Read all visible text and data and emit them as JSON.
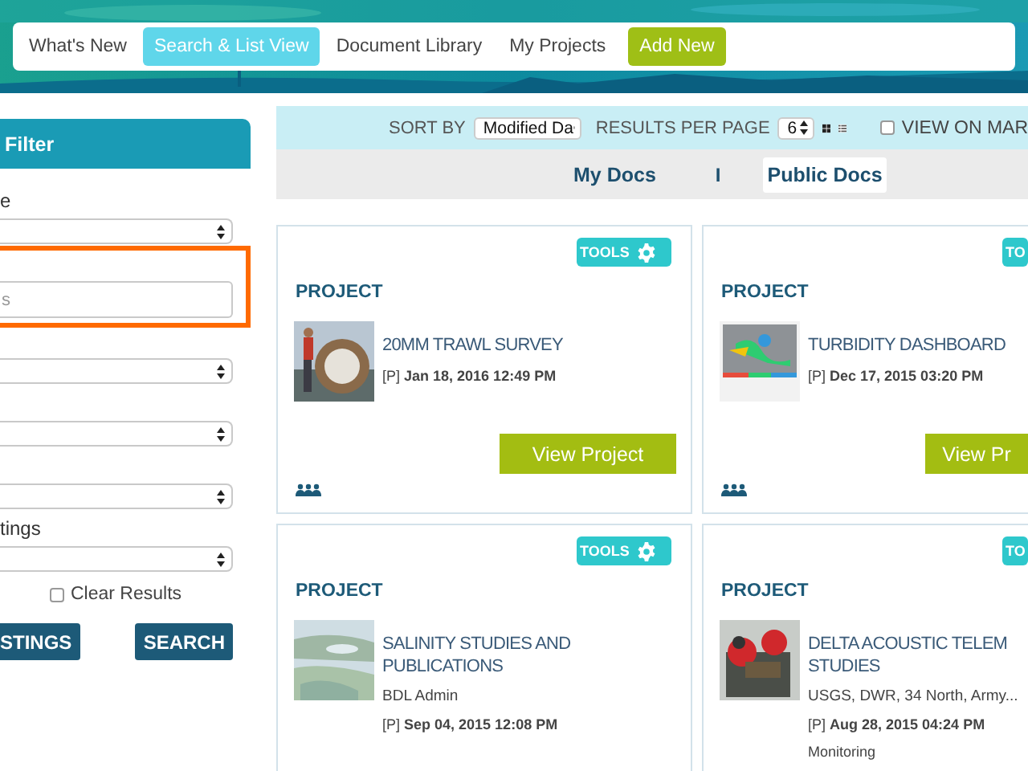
{
  "nav": {
    "items": [
      {
        "label": "What's New",
        "selected": false,
        "kind": "link"
      },
      {
        "label": "Search & List View",
        "selected": true,
        "kind": "link"
      },
      {
        "label": "Document Library",
        "selected": false,
        "kind": "link"
      },
      {
        "label": "My Projects",
        "selected": false,
        "kind": "link"
      },
      {
        "label": "Add New",
        "selected": false,
        "kind": "action"
      }
    ]
  },
  "sidebar": {
    "title": "Filter",
    "filters": [
      {
        "kind": "select",
        "label": "e",
        "highlighted": false
      },
      {
        "kind": "input",
        "placeholder": "s",
        "highlighted": true
      },
      {
        "kind": "select",
        "highlighted": false
      },
      {
        "kind": "select",
        "highlighted": false
      },
      {
        "kind": "select",
        "highlighted": false
      },
      {
        "kind": "select",
        "label": "tings",
        "highlighted": false
      }
    ],
    "clear_results": {
      "label": "Clear Results",
      "checked": false
    },
    "buttons": [
      "STINGS",
      "SEARCH"
    ]
  },
  "toolbar": {
    "sort_label": "SORT BY",
    "sort_value": "Modified Da",
    "per_page_label": "RESULTS PER PAGE",
    "per_page_value": "6",
    "views": [
      {
        "kind": "grid",
        "selected": true
      },
      {
        "kind": "list",
        "selected": false
      }
    ],
    "map_toggle": {
      "label": "VIEW ON MAR",
      "checked": false
    }
  },
  "doc_tabs": {
    "separator": "I",
    "tabs": [
      {
        "label": "My Docs",
        "selected": false
      },
      {
        "label": "Public Docs",
        "selected": true
      }
    ]
  },
  "cards": [
    {
      "tools": "TOOLS",
      "gear": true,
      "type": "PROJECT",
      "title_lines": [
        "20MM TRAWL SURVEY"
      ],
      "date": "[P] **Jan 18, 2016 12:49 PM**",
      "button": "View Project",
      "members": true
    },
    {
      "tools": "TO",
      "gear": false,
      "type": "PROJECT",
      "title_lines": [
        "TURBIDITY DASHBOARD"
      ],
      "date": "[P] **Dec 17, 2015 03:20 PM**",
      "button": "View Pr",
      "members": true
    },
    {
      "tools": "TOOLS",
      "gear": true,
      "type": "PROJECT",
      "title_lines": [
        "SALINITY STUDIES AND",
        "PUBLICATIONS"
      ],
      "author": "BDL Admin",
      "date": "[P] **Sep 04, 2015 12:08 PM**",
      "members": false
    },
    {
      "tools": "TO",
      "gear": false,
      "type": "PROJECT",
      "title_lines": [
        "DELTA ACOUSTIC TELEM",
        "STUDIES"
      ],
      "author": "USGS, DWR, 34 North, Army...",
      "date": "[P] **Aug 28, 2015 04:24 PM**",
      "category": "Monitoring",
      "members": false
    }
  ]
}
